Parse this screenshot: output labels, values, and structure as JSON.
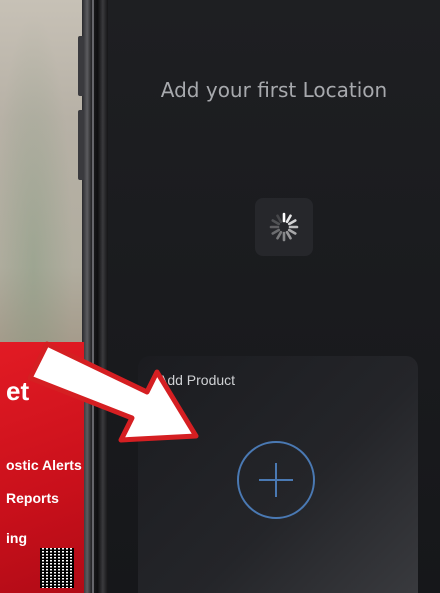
{
  "background_photo": {
    "sign_heading": "et",
    "sign_line1": "ostic Alerts",
    "sign_line2": "Reports",
    "sign_line3": "ing"
  },
  "screen": {
    "title": "Add your first Location",
    "spinner_icon": "loading-spinner-icon",
    "product_card": {
      "label": "Add Product",
      "add_icon": "plus-circle-icon"
    }
  },
  "overlay": {
    "arrow_icon": "pointer-arrow-icon",
    "colors": {
      "arrow_fill": "#ffffff",
      "arrow_outline": "#d51f22",
      "accent": "#4a79b3"
    }
  }
}
